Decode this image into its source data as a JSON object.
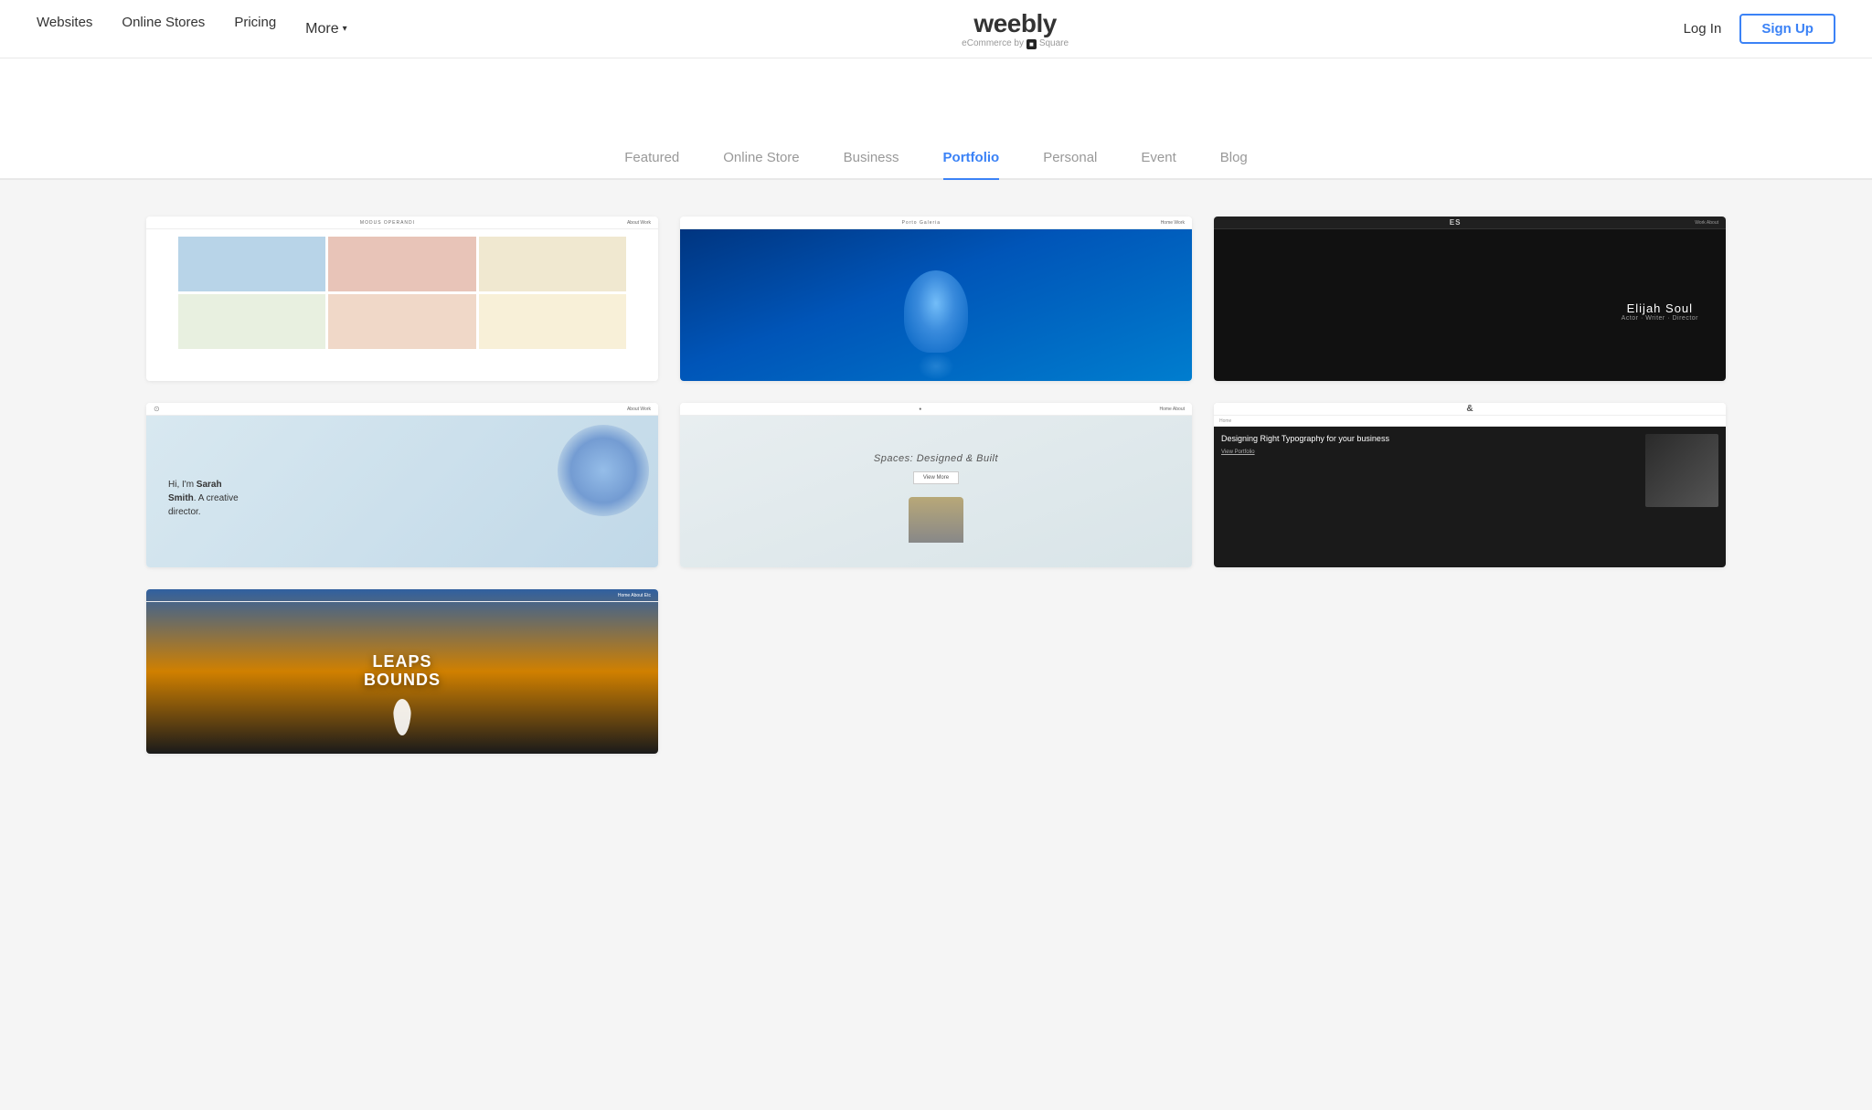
{
  "brand": {
    "name": "weebly",
    "tagline": "eCommerce by",
    "square": "Square"
  },
  "nav": {
    "links": [
      {
        "id": "websites",
        "label": "Websites"
      },
      {
        "id": "online-stores",
        "label": "Online Stores"
      },
      {
        "id": "pricing",
        "label": "Pricing"
      },
      {
        "id": "more",
        "label": "More"
      }
    ],
    "login_label": "Log In",
    "signup_label": "Sign Up"
  },
  "tabs": [
    {
      "id": "featured",
      "label": "Featured",
      "active": false
    },
    {
      "id": "online-store",
      "label": "Online Store",
      "active": false
    },
    {
      "id": "business",
      "label": "Business",
      "active": false
    },
    {
      "id": "portfolio",
      "label": "Portfolio",
      "active": true
    },
    {
      "id": "personal",
      "label": "Personal",
      "active": false
    },
    {
      "id": "event",
      "label": "Event",
      "active": false
    },
    {
      "id": "blog",
      "label": "Blog",
      "active": false
    }
  ],
  "themes": [
    {
      "id": "modus-operandi",
      "title": "MODUS OPERANDI",
      "type": "photo-grid",
      "nav_type": "light"
    },
    {
      "id": "porto-galeria",
      "title": "Porto Galeria",
      "type": "jellyfish",
      "nav_type": "light"
    },
    {
      "id": "elijah-soul",
      "title": "ES",
      "name": "Elijah Soul",
      "sub": "Actor · Writer · Director",
      "type": "dark-portrait",
      "nav_type": "dark"
    },
    {
      "id": "sarah-smith",
      "headline": "Hi, I'm Sarah Smith. A creative director.",
      "type": "creative-director",
      "nav_type": "light"
    },
    {
      "id": "spaces",
      "title": "Spaces: Designed & Built",
      "type": "interior",
      "nav_type": "light"
    },
    {
      "id": "typography",
      "ampersand": "&",
      "headline": "Designing Right Typography for your business",
      "view_more": "View Portfolio",
      "type": "typography",
      "nav_type": "dark"
    },
    {
      "id": "leaps-bounds",
      "line1": "LEAPS",
      "line2": "BOUNDS",
      "type": "leaps",
      "nav_type": "light"
    }
  ]
}
